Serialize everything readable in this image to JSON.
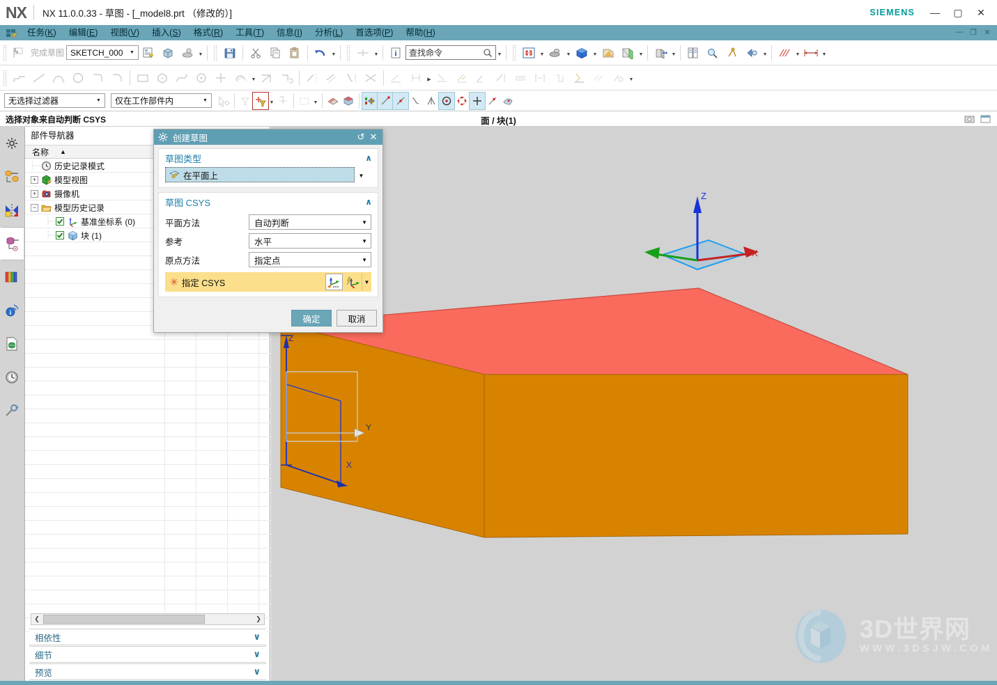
{
  "window": {
    "logo": "NX",
    "title": "NX 11.0.0.33 - 草图 - [_model8.prt （修改的）]",
    "brand": "SIEMENS",
    "minimize": "—",
    "maximize": "▢",
    "close": "✕",
    "doc_minimize": "—",
    "doc_restore": "❐",
    "doc_close": "✕"
  },
  "menu": {
    "items": [
      {
        "label": "任务",
        "key": "K"
      },
      {
        "label": "编辑",
        "key": "E"
      },
      {
        "label": "视图",
        "key": "V"
      },
      {
        "label": "插入",
        "key": "S"
      },
      {
        "label": "格式",
        "key": "R"
      },
      {
        "label": "工具",
        "key": "T"
      },
      {
        "label": "信息",
        "key": "I"
      },
      {
        "label": "分析",
        "key": "L"
      },
      {
        "label": "首选项",
        "key": "P"
      },
      {
        "label": "帮助",
        "key": "H"
      }
    ]
  },
  "toolbar": {
    "finish_sketch_label": "完成草图",
    "sketch_name": "SKETCH_000",
    "search_value": "查找命令"
  },
  "selection_bar": {
    "filter_value": "无选择过滤器",
    "scope_value": "仅在工作部件内"
  },
  "cue": {
    "text": "选择对象来自动判断 CSYS",
    "view_title": "面 / 块(1)"
  },
  "navigator": {
    "title": "部件导航器",
    "column_name": "名称",
    "sort_arrow": "▲",
    "tree": [
      {
        "label": "历史记录模式",
        "icon": "clock-icon",
        "indent": 0,
        "expander": "",
        "check": false
      },
      {
        "label": "模型视图",
        "icon": "model-view-icon",
        "indent": 0,
        "expander": "+",
        "check": false
      },
      {
        "label": "摄像机",
        "icon": "camera-icon",
        "indent": 0,
        "expander": "+",
        "check": false
      },
      {
        "label": "模型历史记录",
        "icon": "folder-icon",
        "indent": 0,
        "expander": "−",
        "check": false
      },
      {
        "label": "基准坐标系 (0)",
        "icon": "datum-csys-icon",
        "indent": 1,
        "expander": "",
        "check": true
      },
      {
        "label": "块 (1)",
        "icon": "block-icon",
        "indent": 1,
        "expander": "",
        "check": true
      }
    ],
    "panels": [
      {
        "label": "相依性",
        "chev": "∨"
      },
      {
        "label": "细节",
        "chev": "∨"
      },
      {
        "label": "预览",
        "chev": "∨"
      }
    ],
    "scroll_left": "❮",
    "scroll_right": "❯"
  },
  "dialog": {
    "title": "创建草图",
    "reset_icon": "↺",
    "close_icon": "✕",
    "groups": [
      {
        "label": "草图类型",
        "chev": "∧"
      },
      {
        "label": "草图 CSYS",
        "chev": "∧"
      }
    ],
    "sketch_type_value": "在平面上",
    "fields": [
      {
        "label": "平面方法",
        "value": "自动判断"
      },
      {
        "label": "参考",
        "value": "水平"
      },
      {
        "label": "原点方法",
        "value": "指定点"
      }
    ],
    "csys_row": {
      "required_marker": "✳",
      "label": "指定 CSYS",
      "carat": "▼"
    },
    "ok_label": "确定",
    "cancel_label": "取消"
  },
  "viewport": {
    "triad_labels": {
      "x": "X",
      "y": "Y",
      "z": "Z"
    },
    "colors": {
      "top_face": "#fa6b5e",
      "side_face": "#d88300",
      "side_face_dark": "#c97a00",
      "background": "#d2d2d2",
      "axis_x": "#d82020",
      "axis_y": "#17a017",
      "axis_z": "#1733d8",
      "plane_fill": "#a8c4d8",
      "plane_border": "#1e9cf0"
    }
  },
  "watermark": {
    "line1": "3D世界网",
    "line2": "WWW.3DSJW.COM"
  }
}
